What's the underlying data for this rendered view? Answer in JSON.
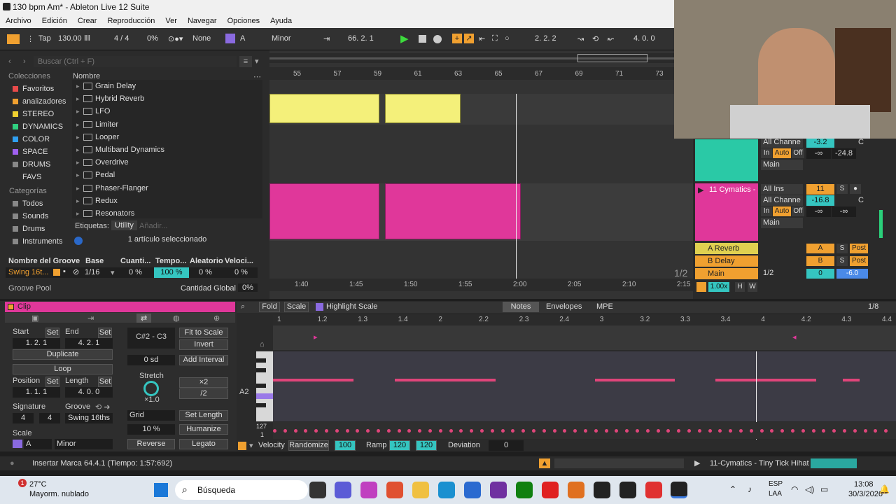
{
  "window": {
    "title": "130 bpm Am* - Ableton Live 12 Suite"
  },
  "menu": [
    "Archivo",
    "Edición",
    "Crear",
    "Reproducción",
    "Ver",
    "Navegar",
    "Opciones",
    "Ayuda"
  ],
  "transport": {
    "tap": "Tap",
    "tempo": "130.00",
    "meter": "4 / 4",
    "swing": "0%",
    "quant": "None",
    "key": "A",
    "scale": "Minor",
    "position": "66.  2.  1",
    "loop_start": "2.  2.  2",
    "loop_len": "4.  0.  0"
  },
  "browser": {
    "search_placeholder": "Buscar (Ctrl + F)",
    "collections_title": "Colecciones",
    "collections": [
      {
        "label": "Favoritos",
        "color": "#e84a4a"
      },
      {
        "label": "analizadores",
        "color": "#f0a030"
      },
      {
        "label": "STEREO",
        "color": "#f0d030"
      },
      {
        "label": "DYNAMICS",
        "color": "#30d080"
      },
      {
        "label": "COLOR",
        "color": "#30a0f0"
      },
      {
        "label": "SPACE",
        "color": "#a060f0"
      },
      {
        "label": "DRUMS FAVS",
        "color": "#888888"
      }
    ],
    "categories_title": "Categorías",
    "categories": [
      "Todos",
      "Sounds",
      "Drums",
      "Instruments"
    ],
    "name_header": "Nombre",
    "items": [
      "Grain Delay",
      "Hybrid Reverb",
      "LFO",
      "Limiter",
      "Looper",
      "Multiband Dynamics",
      "Overdrive",
      "Pedal",
      "Phaser-Flanger",
      "Redux",
      "Resonators"
    ],
    "tags_label": "Etiquetas:",
    "tag": "Utility",
    "tag_add": "Añadir...",
    "selection": "1 artículo seleccionado"
  },
  "groove": {
    "headers": [
      "Nombre del Groove",
      "Base",
      "Cuanti...",
      "Tempo...",
      "Aleatorio",
      "Veloci..."
    ],
    "row": {
      "name": "Swing 16t...",
      "base": "1/16",
      "quant": "0 %",
      "timing": "100 %",
      "random": "0 %",
      "velocity": "0 %"
    },
    "pool_label": "Groove Pool",
    "global_label": "Cantidad Global",
    "global_value": "0%"
  },
  "arrangement": {
    "bars": [
      "55",
      "57",
      "59",
      "61",
      "63",
      "65",
      "67",
      "69",
      "71",
      "73"
    ],
    "times": [
      "1:40",
      "1:45",
      "1:50",
      "1:55",
      "2:00",
      "2:05",
      "2:10",
      "2:15"
    ],
    "page": "1/2"
  },
  "mixer": {
    "track10": {
      "input": "All Channe",
      "vol": "-3.2",
      "pan": "C",
      "in": "In",
      "auto": "Auto",
      "off": "Off",
      "send1": "-∞",
      "send2": "-24.8",
      "out": "Main"
    },
    "track11": {
      "name": "11 Cymatics -",
      "input": "All Ins",
      "channel": "All Channe",
      "num": "11",
      "s": "S",
      "vol": "-16.8",
      "pan": "C",
      "in": "In",
      "auto": "Auto",
      "off": "Off",
      "send1": "-∞",
      "send2": "-∞",
      "out": "Main"
    },
    "returns": [
      {
        "name": "A Reverb",
        "letter": "A",
        "s": "S",
        "post": "Post",
        "color": "#e0d050"
      },
      {
        "name": "B Delay",
        "letter": "B",
        "s": "S",
        "post": "Post",
        "color": "#f0a030"
      }
    ],
    "main": {
      "name": "Main",
      "ratio": "1/2",
      "vol": "0",
      "db": "-6.0"
    },
    "zoom": "1.00x",
    "h": "H",
    "w": "W"
  },
  "clip": {
    "title": "Clip",
    "start_label": "Start",
    "end_label": "End",
    "set": "Set",
    "start": "1.  2.  1",
    "end": "4.  2.  1",
    "duplicate": "Duplicate",
    "loop": "Loop",
    "position_label": "Position",
    "length_label": "Length",
    "position": "1.  1.  1",
    "length": "4.  0.  0",
    "signature_label": "Signature",
    "groove_label": "Groove",
    "sig_num": "4",
    "sig_den": "4",
    "groove": "Swing 16ths",
    "scale_label": "Scale",
    "scale_key": "A",
    "scale_mode": "Minor",
    "range": "C#2 - C3",
    "fit": "Fit to Scale",
    "invert": "Invert",
    "sd": "0 sd",
    "add_interval": "Add Interval",
    "stretch": "Stretch",
    "stretch_val": "×1.0",
    "x2": "×2",
    "div2": "/2",
    "grid": "Grid",
    "set_length": "Set Length",
    "percent": "10 %",
    "humanize": "Humanize",
    "reverse": "Reverse",
    "legato": "Legato"
  },
  "pianoroll": {
    "fold": "Fold",
    "scale": "Scale",
    "highlight": "Highlight Scale",
    "tabs": [
      "Notes",
      "Envelopes",
      "MPE"
    ],
    "grid": "1/8",
    "beats": [
      "1",
      "1.2",
      "1.3",
      "1.4",
      "2",
      "2.2",
      "2.3",
      "2.4",
      "3",
      "3.2",
      "3.3",
      "3.4",
      "4",
      "4.2",
      "4.3",
      "4.4"
    ],
    "key_label": "A2",
    "vel_max": "127",
    "vel_min": "1",
    "velocity_label": "Velocity",
    "randomize": "Randomize",
    "vel_val": "100",
    "ramp": "Ramp",
    "ramp1": "120",
    "ramp2": "120",
    "deviation": "Deviation",
    "dev_val": "0"
  },
  "status": {
    "message": "Insertar Marca 64.4.1 (Tiempo: 1:57:692)",
    "track": "11-Cymatics - Tiny Tick Hihat"
  },
  "taskbar": {
    "temp": "27°C",
    "weather": "Mayorm. nublado",
    "badge": "1",
    "search": "Búsqueda",
    "lang1": "ESP",
    "lang2": "LAA",
    "time": "13:08",
    "date": "30/3/2026"
  }
}
